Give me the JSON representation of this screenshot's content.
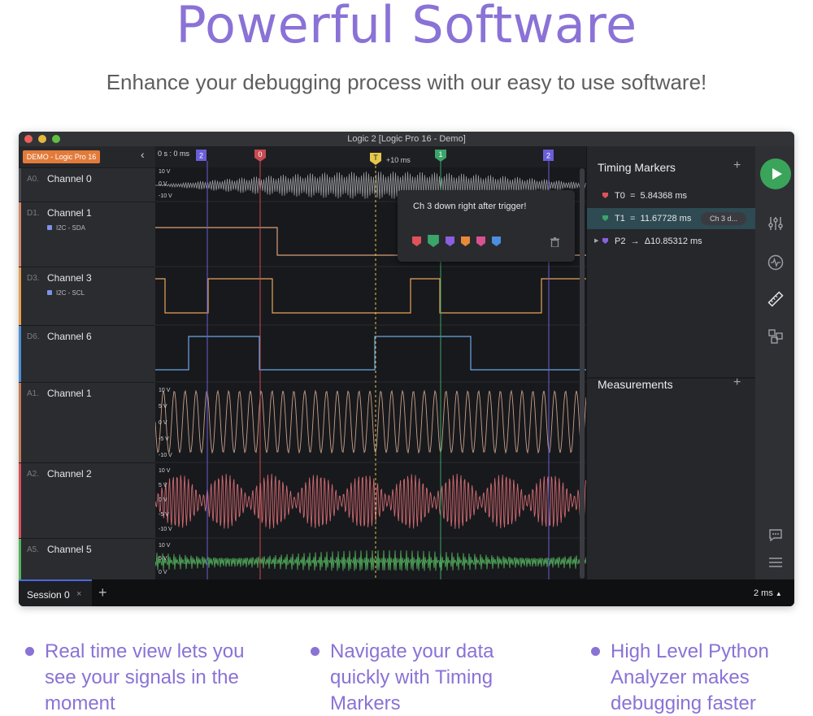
{
  "hero": {
    "title": "Powerful Software",
    "subtitle": "Enhance your debugging process with our easy to use software!"
  },
  "window": {
    "title": "Logic 2 [Logic Pro 16 - Demo]",
    "device_badge": "DEMO - Logic Pro 16"
  },
  "timeline": {
    "start_label": "0 s : 0 ms",
    "offset_label": "+10 ms",
    "markers": [
      "2",
      "0",
      "T",
      "1",
      "2"
    ]
  },
  "channels": [
    {
      "id": "A0.",
      "name": "Channel 0",
      "color": "#6b6c72",
      "analyzer": "",
      "scale": [
        "10 V",
        "0 V",
        "-10 V"
      ]
    },
    {
      "id": "D1.",
      "name": "Channel 1",
      "color": "#d0876a",
      "analyzer": "I2C - SDA",
      "scale": []
    },
    {
      "id": "D3.",
      "name": "Channel 3",
      "color": "#e6a04a",
      "analyzer": "I2C - SCL",
      "scale": []
    },
    {
      "id": "D6.",
      "name": "Channel 6",
      "color": "#4d8fd6",
      "analyzer": "",
      "scale": []
    },
    {
      "id": "A1.",
      "name": "Channel 1",
      "color": "#c47a55",
      "analyzer": "",
      "scale": [
        "10 V",
        "5 V",
        "0 V",
        "-5 V",
        "-10 V"
      ]
    },
    {
      "id": "A2.",
      "name": "Channel 2",
      "color": "#d8505a",
      "analyzer": "",
      "scale": [
        "10 V",
        "5 V",
        "0 V",
        "-5 V",
        "-10 V"
      ]
    },
    {
      "id": "A5.",
      "name": "Channel 5",
      "color": "#4fb55a",
      "analyzer": "",
      "scale": [
        "10 V",
        "5 V",
        "0 V"
      ]
    }
  ],
  "popup": {
    "note": "Ch 3 down right after trigger!",
    "flag_colors": [
      "#e0525a",
      "#3aa56a",
      "#8a5fe0",
      "#e88a3a",
      "#d85290",
      "#4a8fe0"
    ]
  },
  "timing_markers": {
    "title": "Timing Markers",
    "add": "+",
    "rows": [
      {
        "marker": "T0",
        "op": "=",
        "value": "5.84368 ms",
        "color": "#e0525a",
        "note": ""
      },
      {
        "marker": "T1",
        "op": "=",
        "value": "11.67728 ms",
        "color": "#3aa56a",
        "note": "Ch 3 d..."
      },
      {
        "marker": "P2",
        "op": "→",
        "value": "Δ10.85312 ms",
        "color": "#8a5fe0",
        "note": ""
      }
    ]
  },
  "measurements": {
    "title": "Measurements",
    "add": "+"
  },
  "toolbar": {
    "icons": [
      "play-icon",
      "sliders-icon",
      "waveform-icon",
      "ruler-icon",
      "layout-icon",
      "comment-icon",
      "menu-icon"
    ]
  },
  "session": {
    "tab": "Session 0",
    "close": "×",
    "add": "+",
    "zoom": "2 ms"
  },
  "features": [
    {
      "text": "Real time view lets you see your signals in the moment"
    },
    {
      "text": "Navigate your data quickly with Timing Markers"
    },
    {
      "text": "High Level Python Analyzer makes debugging faster"
    }
  ]
}
